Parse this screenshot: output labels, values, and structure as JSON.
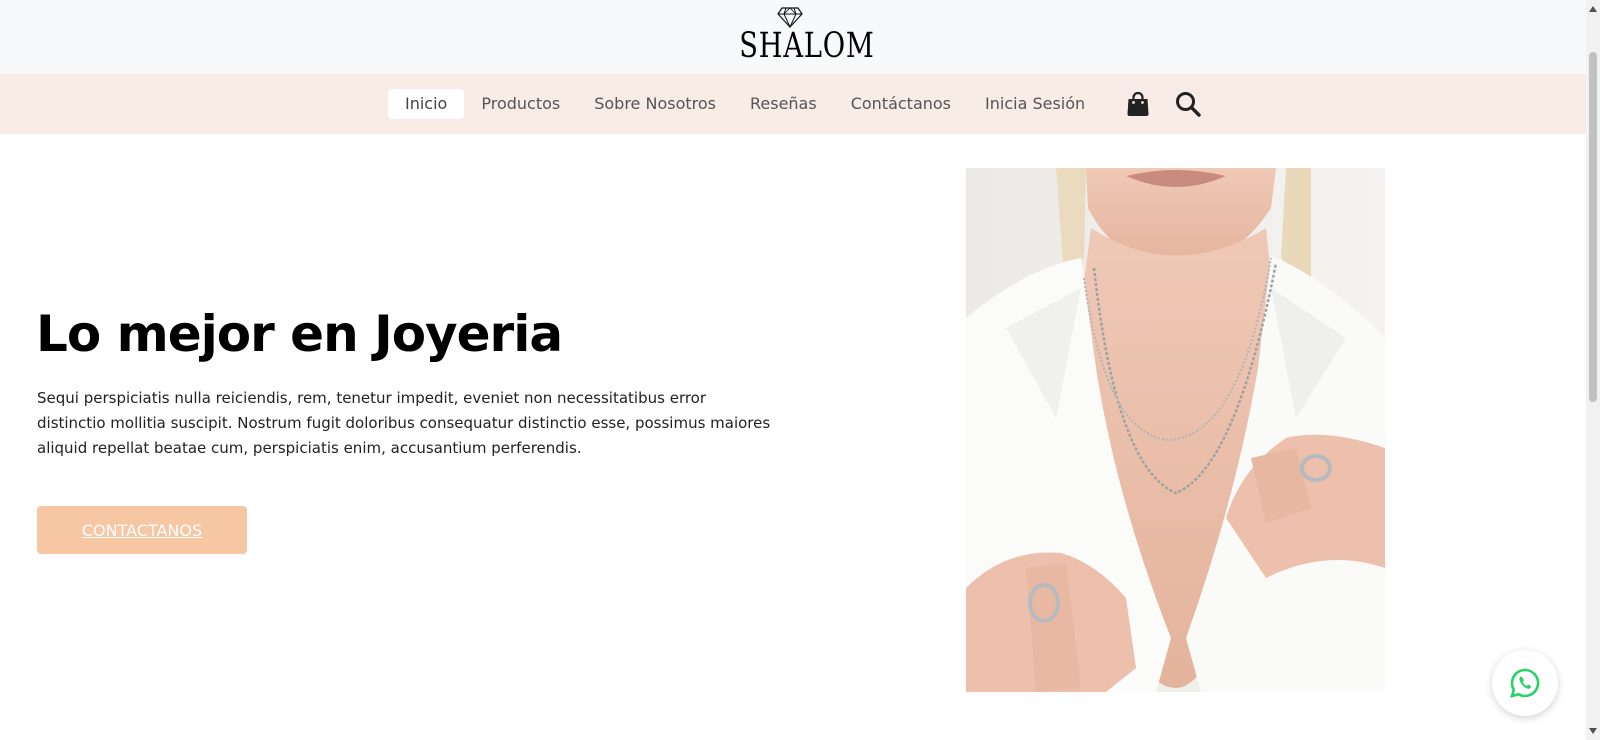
{
  "header": {
    "logo_text": "SHALOM",
    "logo_icon": "diamond-icon"
  },
  "nav": {
    "items": [
      {
        "label": "Inicio",
        "active": true
      },
      {
        "label": "Productos",
        "active": false
      },
      {
        "label": "Sobre Nosotros",
        "active": false
      },
      {
        "label": "Reseñas",
        "active": false
      },
      {
        "label": "Contáctanos",
        "active": false
      },
      {
        "label": "Inicia Sesión",
        "active": false
      }
    ],
    "icons": [
      "shopping-bag-icon",
      "search-icon"
    ]
  },
  "hero": {
    "title": "Lo mejor en Joyeria",
    "text": "Sequi perspiciatis nulla reiciendis, rem, tenetur impedit, eveniet non necessitatibus error distinctio mollitia suscipit. Nostrum fugit doloribus consequatur distinctio esse, possimus maiores aliquid repellat beatae cum, perspiciatis enim, accusantium perferendis.",
    "button_label": "CONTACTANOS"
  },
  "floating": {
    "icon": "whatsapp-icon"
  },
  "colors": {
    "nav_background": "#f9ebe6",
    "button_background": "#f7c6a3",
    "whatsapp_green": "#25d366",
    "logo_bar_background": "#f8f9fa"
  }
}
